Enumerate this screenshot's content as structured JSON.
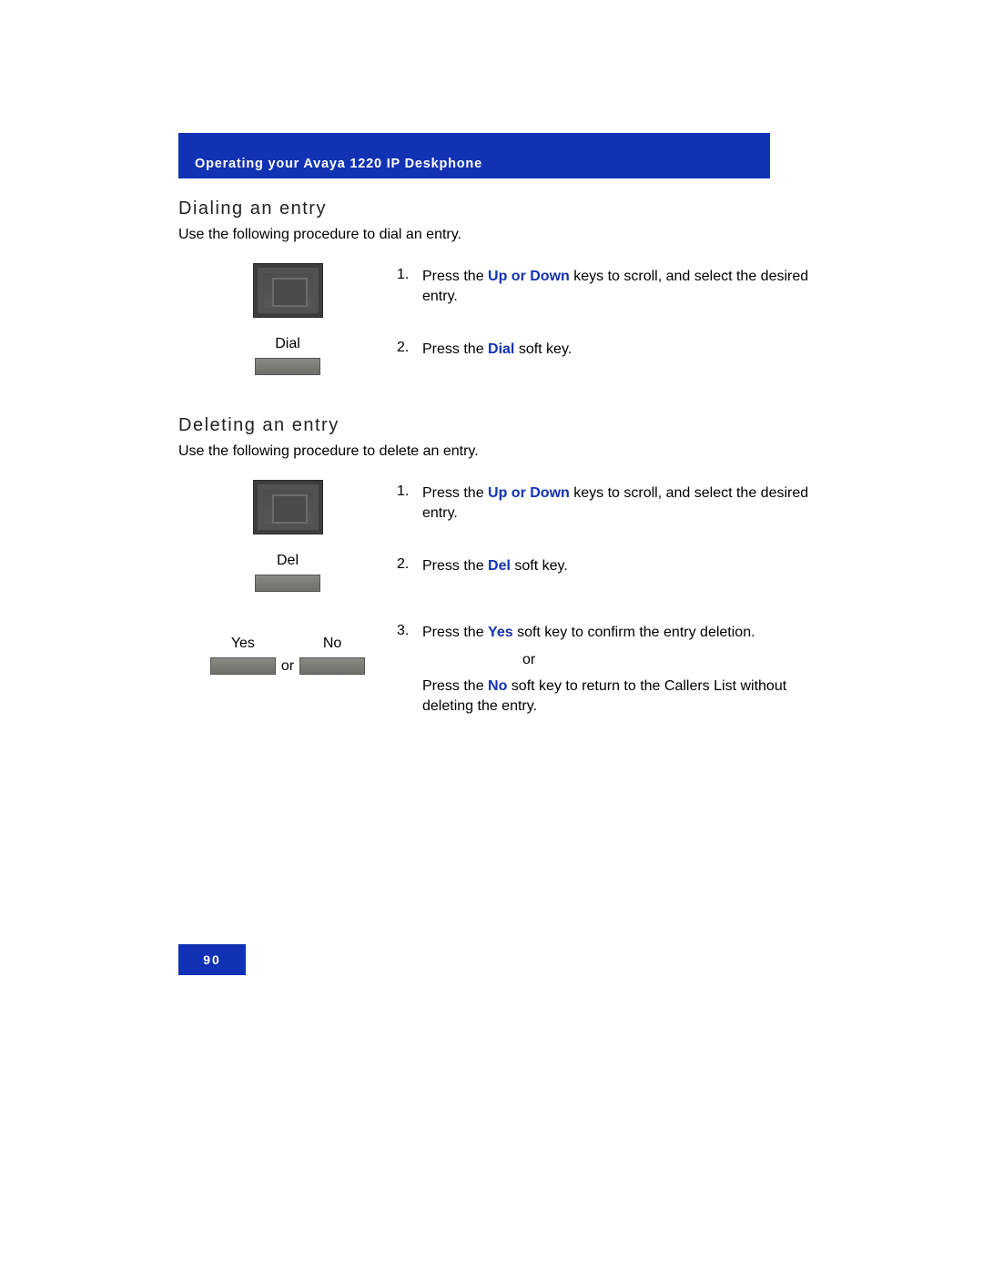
{
  "header": {
    "title": "Operating your Avaya 1220 IP Deskphone"
  },
  "section1": {
    "heading": "Dialing an entry",
    "intro": "Use the following procedure to dial an entry.",
    "steps": [
      {
        "num": "1.",
        "text_before": "Press the ",
        "bold": "Up or Down",
        "text_after": " keys to scroll, and select the desired entry."
      },
      {
        "num": "2.",
        "label": "Dial",
        "text_before": "Press the ",
        "bold": "Dial",
        "text_after": " soft key."
      }
    ]
  },
  "section2": {
    "heading": "Deleting an entry",
    "intro": "Use the following procedure to delete an entry.",
    "steps": [
      {
        "num": "1.",
        "text_before": "Press the ",
        "bold": "Up or Down",
        "text_after": " keys to scroll, and select the desired entry."
      },
      {
        "num": "2.",
        "label": "Del",
        "text_before": "Press the ",
        "bold": "Del",
        "text_after": " soft key."
      },
      {
        "num": "3.",
        "labels": {
          "yes": "Yes",
          "or": "or",
          "no": "No"
        },
        "text_before": "Press the ",
        "bold": "Yes",
        "text_after": " soft key to confirm the entry deletion.",
        "sub_or": "or",
        "text2_before": "Press the ",
        "bold2": "No",
        "text2_after": " soft key to return to the Callers List without deleting the entry."
      }
    ]
  },
  "footer": {
    "page": "90"
  }
}
